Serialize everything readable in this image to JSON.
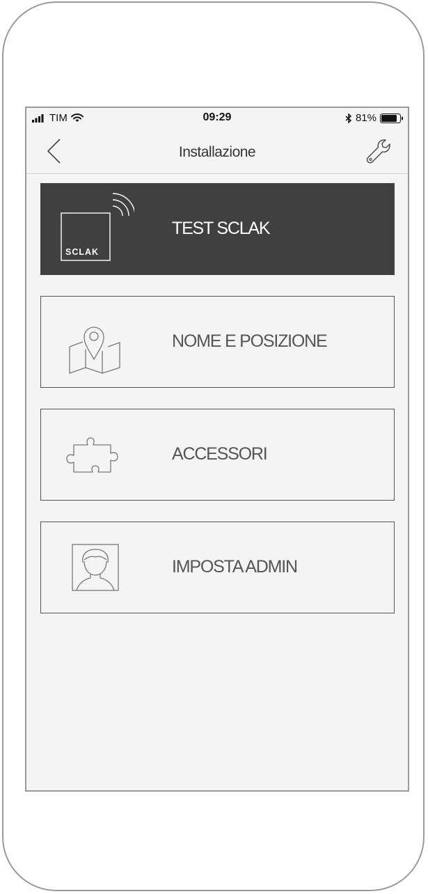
{
  "status_bar": {
    "carrier": "TIM",
    "time": "09:29",
    "battery": "81%"
  },
  "nav": {
    "title": "Installazione",
    "back_icon": "chevron-left-icon",
    "settings_icon": "wrench-icon"
  },
  "menu": {
    "items": [
      {
        "label": "TEST SCLAK",
        "icon": "sclak-device-icon"
      },
      {
        "label": "NOME E POSIZIONE",
        "icon": "map-pin-icon"
      },
      {
        "label": "ACCESSORI",
        "icon": "puzzle-icon"
      },
      {
        "label": "IMPOSTA ADMIN",
        "icon": "admin-user-icon"
      }
    ],
    "logo_text": "SCLAK"
  },
  "colors": {
    "screen_bg": "#f4f4f4",
    "active_item_bg": "#404040",
    "border": "#555555",
    "text": "#555555"
  }
}
